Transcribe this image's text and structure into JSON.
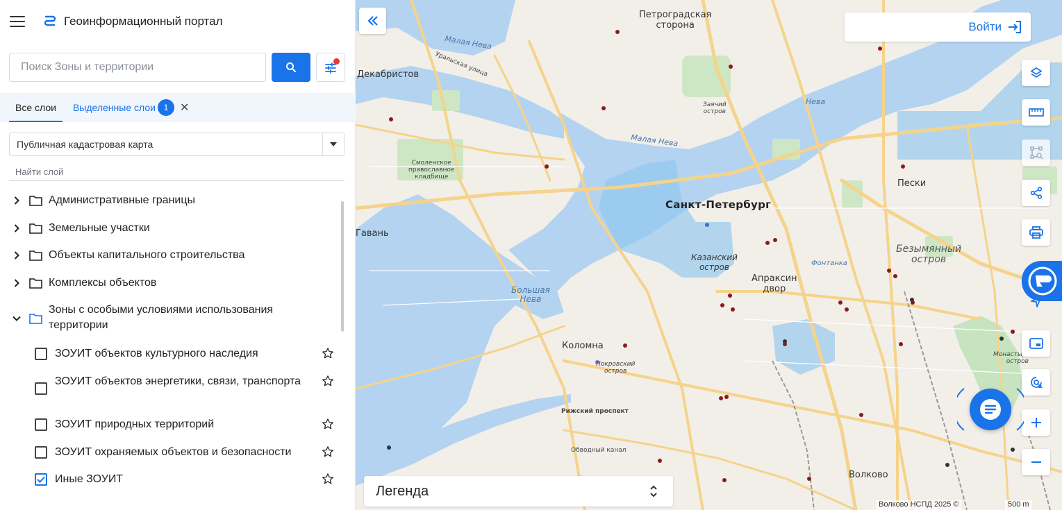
{
  "app": {
    "title": "Геоинформационный портал"
  },
  "search": {
    "placeholder": "Поиск Зоны и территории"
  },
  "tabs": {
    "all_layers": "Все слои",
    "selected_layers": "Выделенные слои",
    "selected_count": "1"
  },
  "basemap_select": {
    "value": "Публичная кадастровая карта"
  },
  "layer_search": {
    "placeholder": "Найти слой"
  },
  "tree": {
    "groups": [
      {
        "label": "Административные границы",
        "expanded": false
      },
      {
        "label": "Земельные участки",
        "expanded": false
      },
      {
        "label": "Объекты капитального строительства",
        "expanded": false
      },
      {
        "label": "Комплексы объектов",
        "expanded": false
      },
      {
        "label": "Зоны с особыми условиями использования территории",
        "expanded": true
      }
    ],
    "items": [
      {
        "label": "ЗОУИТ объектов культурного наследия",
        "checked": false
      },
      {
        "label": "ЗОУИТ объектов энергетики, связи, транспорта",
        "checked": false
      },
      {
        "label": "ЗОУИТ природных территорий",
        "checked": false
      },
      {
        "label": "ЗОУИТ охраняемых объектов и безопасности",
        "checked": false
      },
      {
        "label": "Иные ЗОУИТ",
        "checked": true
      }
    ]
  },
  "map": {
    "login_label": "Войти",
    "legend_label": "Легенда",
    "attribution": "Волково НСПД 2025 ©",
    "scale_label": "500 m",
    "labels": {
      "city": "Санкт-Петербург",
      "petrogradskaya": "Петроградская\nсторона",
      "dekabristov": "Декабристов",
      "gavan": "Гавань",
      "kolomna": "Коломна",
      "kazansky": "Казанский\nостров",
      "apraksin": "Апраксин\nдвор",
      "bezymyanny": "Безымянный\nостров",
      "peski": "Пески",
      "volkovo": "Волково",
      "zayachy": "Заячий\nостров",
      "smolenskoe": "Смоленское\nправославное\nкладбище",
      "pokrovsky": "Покровский\nостров",
      "monastyrsky": "Монастырский\nостров",
      "malaya_neva": "Малая Нева",
      "bolshaya_neva": "Большая\nНева",
      "neva": "Нева",
      "rizhsky": "Рижский проспект",
      "fontanka": "Фонтанка",
      "uralskaya": "Уральская улица",
      "obvodny": "Обводный канал"
    }
  }
}
